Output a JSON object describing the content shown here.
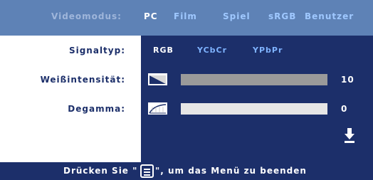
{
  "header": {
    "mode_title": "Videomodus:",
    "modes": [
      "PC",
      "Film",
      "Spiel",
      "sRGB",
      "Benutzer"
    ],
    "active_mode": "PC"
  },
  "rows": {
    "signal": {
      "label": "Signaltyp:",
      "options": [
        "RGB",
        "YCbCr",
        "YPbPr"
      ],
      "active": "RGB"
    },
    "white_intensity": {
      "label": "Weißintensität:",
      "value": "10",
      "level_fraction": 1.0
    },
    "degamma": {
      "label": "Degamma:",
      "value": "0",
      "level_fraction": 0.0
    }
  },
  "footer": {
    "prefix": "Drücken Sie \"",
    "suffix": "\", um das Menü zu beenden",
    "key_icon": "menu-button-icon"
  },
  "icons": {
    "more_below": "arrow-down-icon"
  },
  "colors": {
    "header_bg": "#5e82b6",
    "panel_bg": "#1c2f6a",
    "active_text": "#ffffff",
    "inactive_text": "#7fb3ff"
  }
}
